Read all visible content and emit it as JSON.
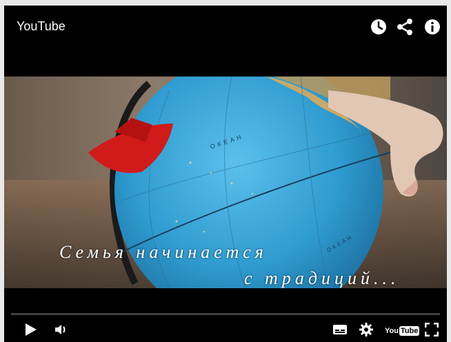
{
  "header": {
    "title": "YouTube",
    "icons": [
      "clock-icon",
      "share-icon",
      "info-icon"
    ]
  },
  "video": {
    "caption_line1": "Семья  начинается",
    "caption_line2": "с  традиций...",
    "globe_label": "ОКЕАН",
    "globe_label_2": "ОКЕАН"
  },
  "controls": {
    "left": [
      "play-icon",
      "volume-icon"
    ],
    "right": [
      "captions-icon",
      "settings-icon",
      "youtube-logo",
      "fullscreen-icon"
    ],
    "logo_you": "You",
    "logo_tube": "Tube"
  },
  "colors": {
    "player_bg": "#000000",
    "page_bg": "#e9e9e9",
    "ocean": "#3aa3d6",
    "boat": "#d11a1a"
  }
}
